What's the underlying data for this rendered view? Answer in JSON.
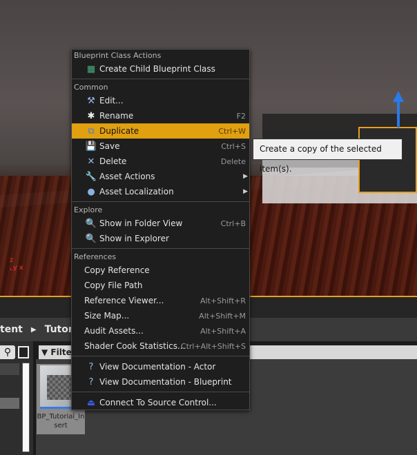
{
  "breadcrumb": {
    "items": [
      "tent",
      "Tutoria"
    ]
  },
  "filters_label": "Filters",
  "asset": {
    "name": "BP_Tutorial_Insert"
  },
  "colors": {
    "highlight": "#e0a010",
    "selection_outline": "#e8a020"
  },
  "menu": {
    "sections": [
      {
        "header": "Blueprint Class Actions",
        "items": [
          {
            "label": "Create Child Blueprint Class",
            "icon": "blueprint-icon",
            "glyph": "▦",
            "color": "#4caf80"
          }
        ]
      },
      {
        "header": "Common",
        "items": [
          {
            "label": "Edit...",
            "icon": "hammer-icon",
            "glyph": "⚒",
            "color": "#9ab8e8"
          },
          {
            "label": "Rename",
            "icon": "rename-icon",
            "glyph": "✱",
            "color": "#eee",
            "shortcut": "F2"
          },
          {
            "label": "Duplicate",
            "icon": "duplicate-icon",
            "glyph": "⧉",
            "color": "#4a7ad8",
            "shortcut": "Ctrl+W",
            "highlighted": true
          },
          {
            "label": "Save",
            "icon": "save-icon",
            "glyph": "💾",
            "color": "#6a9ae8",
            "shortcut": "Ctrl+S"
          },
          {
            "label": "Delete",
            "icon": "delete-icon",
            "glyph": "✕",
            "color": "#9ab8e8",
            "shortcut": "Delete"
          },
          {
            "label": "Asset Actions",
            "icon": "wrench-icon",
            "glyph": "🔧",
            "color": "#9ab8e8",
            "submenu": true
          },
          {
            "label": "Asset Localization",
            "icon": "globe-icon",
            "glyph": "●",
            "color": "#8ab0e0",
            "submenu": true
          }
        ]
      },
      {
        "header": "Explore",
        "items": [
          {
            "label": "Show in Folder View",
            "icon": "magnifier-icon",
            "glyph": "🔍",
            "color": "#ccc",
            "shortcut": "Ctrl+B"
          },
          {
            "label": "Show in Explorer",
            "icon": "magnifier-icon",
            "glyph": "🔍",
            "color": "#ccc"
          }
        ]
      },
      {
        "header": "References",
        "items": [
          {
            "label": "Copy Reference"
          },
          {
            "label": "Copy File Path"
          },
          {
            "label": "Reference Viewer...",
            "shortcut": "Alt+Shift+R"
          },
          {
            "label": "Size Map...",
            "shortcut": "Alt+Shift+M"
          },
          {
            "label": "Audit Assets...",
            "shortcut": "Alt+Shift+A"
          },
          {
            "label": "Shader Cook Statistics...",
            "shortcut": "Ctrl+Alt+Shift+S"
          }
        ]
      },
      {
        "header": "",
        "items": [
          {
            "label": "View Documentation - Actor",
            "icon": "help-icon",
            "glyph": "?",
            "color": "#9ab8e8"
          },
          {
            "label": "View Documentation - Blueprint",
            "icon": "help-icon",
            "glyph": "?",
            "color": "#9ab8e8"
          }
        ]
      },
      {
        "header": "",
        "items": [
          {
            "label": "Connect To Source Control...",
            "icon": "source-control-icon",
            "glyph": "⏏",
            "color": "#3a5ae8"
          }
        ]
      }
    ]
  },
  "tooltip": "Create a copy of the selected item(s)."
}
